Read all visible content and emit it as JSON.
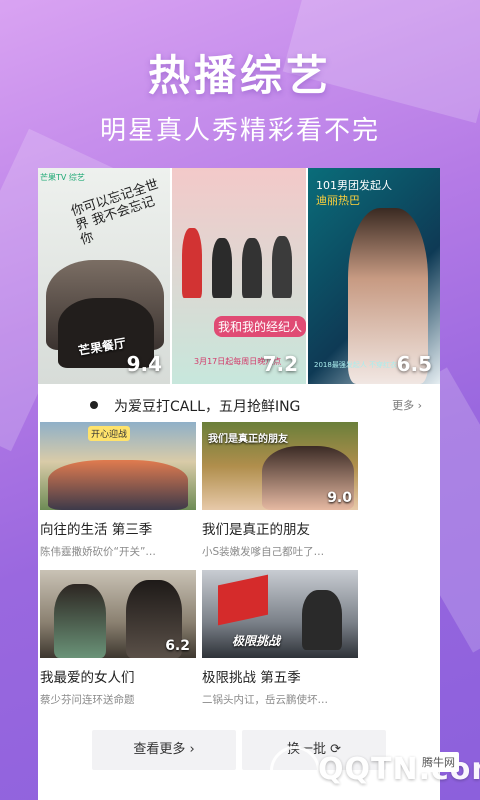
{
  "hero": {
    "title": "热播综艺",
    "subtitle": "明星真人秀精彩看不完"
  },
  "banner": [
    {
      "caption": "你可以忘记全世界 我不会忘记你",
      "show": "芒果餐厅",
      "logo": "芒果TV 综艺",
      "score": "9.4"
    },
    {
      "show": "我和我的经纪人",
      "date": "3月17日起每周日晚八点",
      "score": "7.2"
    },
    {
      "slogan_line1": "101男团发起人",
      "slogan_line2": "迪丽热巴",
      "note": "2018最强发起人 不穿红衣",
      "score": "6.5"
    }
  ],
  "section": {
    "title": "为爱豆打CALL，五月抢鲜ING",
    "more": "更多 ›"
  },
  "shows": [
    {
      "title": "向往的生活 第三季",
      "desc": "陈伟霆撒娇砍价“开关”…",
      "overlay": "开心迎战",
      "score": ""
    },
    {
      "title": "我们是真正的朋友",
      "desc": "小S装嫩发嗲自己都吐了…",
      "overlay": "我们是真正的朋友",
      "score": "9.0"
    },
    {
      "title": "我最爱的女人们",
      "desc": "蔡少芬问连环送命题",
      "overlay": "",
      "score": "6.2"
    },
    {
      "title": "极限挑战 第五季",
      "desc": "二锅头内讧，岳云鹏使坏…",
      "overlay": "极限挑战",
      "score": ""
    }
  ],
  "buttons": {
    "more": "查看更多 ›",
    "refresh": "换一批 ⟳"
  },
  "watermark": {
    "site": "QQTN.com",
    "badge": "腾牛网"
  },
  "colors": {
    "bg_top": "#d9a3f2",
    "bg_bottom": "#8c60dc",
    "score_text": "#ffffff"
  }
}
